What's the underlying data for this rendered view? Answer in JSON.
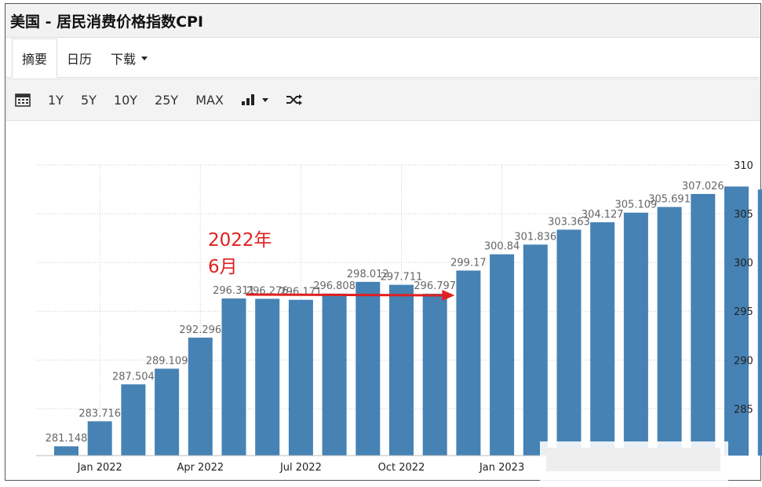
{
  "window": {
    "title": "美国 - 居民消费价格指数CPI"
  },
  "tabs": [
    {
      "label": "摘要",
      "active": true
    },
    {
      "label": "日历",
      "active": false
    },
    {
      "label": "下载",
      "active": false,
      "dropdown": true
    }
  ],
  "toolbar": {
    "calendar_icon": "calendar-icon",
    "ranges": [
      "1Y",
      "5Y",
      "10Y",
      "25Y",
      "MAX"
    ],
    "chart_type_icon": "bar-chart-icon",
    "shuffle_icon": "shuffle-icon"
  },
  "colors": {
    "bar": "#4682b4",
    "annotation": "#e02020"
  },
  "chart_data": {
    "type": "bar",
    "title": "",
    "xlabel": "",
    "ylabel": "",
    "categories": [
      "2021-12",
      "2022-01",
      "2022-02",
      "2022-03",
      "2022-04",
      "2022-05",
      "2022-06",
      "2022-07",
      "2022-08",
      "2022-09",
      "2022-10",
      "2022-11",
      "2022-12",
      "2023-01",
      "2023-02",
      "2023-03",
      "2023-04",
      "2023-05",
      "2023-06",
      "2023-07",
      "2023-08",
      "2023-09"
    ],
    "values": [
      281.148,
      283.716,
      287.504,
      289.109,
      292.296,
      296.311,
      296.276,
      296.171,
      296.808,
      298.012,
      297.711,
      296.797,
      299.17,
      300.84,
      301.836,
      303.363,
      304.127,
      305.109,
      305.691,
      307.026,
      307.789,
      307.481
    ],
    "data_labels": [
      "281.148",
      "283.716",
      "287.504",
      "289.109",
      "292.296",
      "296.311",
      "296.276",
      "296.171",
      "296.808",
      "298.012",
      "297.711",
      "296.797",
      "299.17",
      "300.84",
      "301.836",
      "303.363",
      "304.127",
      "305.109",
      "305.691",
      "307.026",
      "",
      ""
    ],
    "x_tick_labels": [
      "Jan 2022",
      "Apr 2022",
      "Jul 2022",
      "Oct 2022",
      "Jan 2023"
    ],
    "y_ticks": [
      285,
      290,
      295,
      300,
      305,
      310
    ],
    "ylim": [
      280.2,
      310
    ],
    "grid": true,
    "y_axis_side": "right",
    "annotation": {
      "text_line1": "2022年",
      "text_line2": "6月",
      "arrow_from": "2022-05",
      "arrow_to": "2022-12"
    }
  }
}
